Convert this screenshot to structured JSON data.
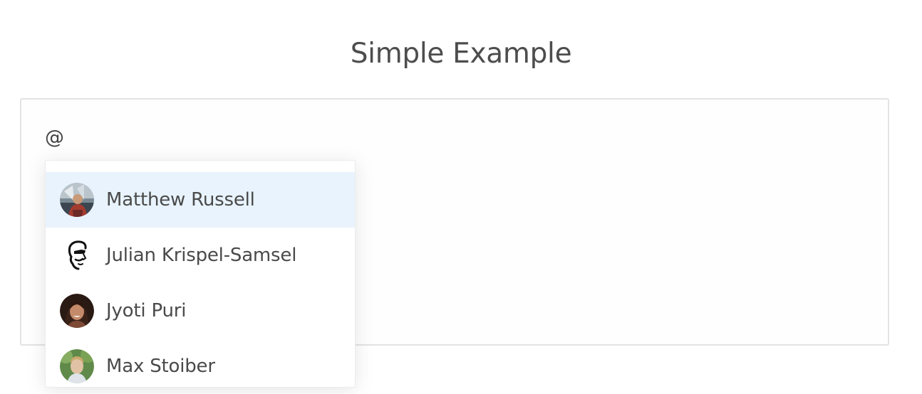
{
  "page": {
    "title": "Simple Example"
  },
  "editor": {
    "text": "@"
  },
  "mentions": {
    "active_index": 0,
    "highlight_color": "#e8f3fd",
    "items": [
      {
        "name": "Matthew Russell",
        "avatar": "photo-avatar"
      },
      {
        "name": "Julian Krispel-Samsel",
        "avatar": "sketch-avatar"
      },
      {
        "name": "Jyoti Puri",
        "avatar": "photo-avatar"
      },
      {
        "name": "Max Stoiber",
        "avatar": "photo-avatar"
      }
    ]
  }
}
